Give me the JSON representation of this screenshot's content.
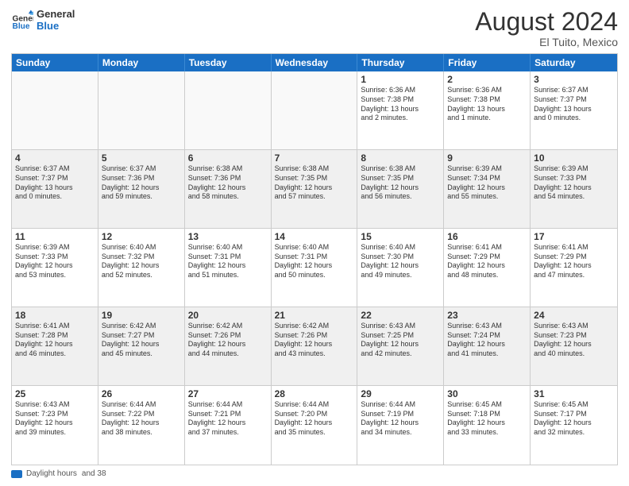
{
  "logo": {
    "line1": "General",
    "line2": "Blue"
  },
  "title": "August 2024",
  "location": "El Tuito, Mexico",
  "header_days": [
    "Sunday",
    "Monday",
    "Tuesday",
    "Wednesday",
    "Thursday",
    "Friday",
    "Saturday"
  ],
  "legend": {
    "label": "Daylight hours",
    "sublabel": "and 38"
  },
  "weeks": [
    {
      "alt": false,
      "days": [
        {
          "num": "",
          "empty": true,
          "lines": []
        },
        {
          "num": "",
          "empty": true,
          "lines": []
        },
        {
          "num": "",
          "empty": true,
          "lines": []
        },
        {
          "num": "",
          "empty": true,
          "lines": []
        },
        {
          "num": "1",
          "empty": false,
          "lines": [
            "Sunrise: 6:36 AM",
            "Sunset: 7:38 PM",
            "Daylight: 13 hours",
            "and 2 minutes."
          ]
        },
        {
          "num": "2",
          "empty": false,
          "lines": [
            "Sunrise: 6:36 AM",
            "Sunset: 7:38 PM",
            "Daylight: 13 hours",
            "and 1 minute."
          ]
        },
        {
          "num": "3",
          "empty": false,
          "lines": [
            "Sunrise: 6:37 AM",
            "Sunset: 7:37 PM",
            "Daylight: 13 hours",
            "and 0 minutes."
          ]
        }
      ]
    },
    {
      "alt": true,
      "days": [
        {
          "num": "4",
          "empty": false,
          "lines": [
            "Sunrise: 6:37 AM",
            "Sunset: 7:37 PM",
            "Daylight: 13 hours",
            "and 0 minutes."
          ]
        },
        {
          "num": "5",
          "empty": false,
          "lines": [
            "Sunrise: 6:37 AM",
            "Sunset: 7:36 PM",
            "Daylight: 12 hours",
            "and 59 minutes."
          ]
        },
        {
          "num": "6",
          "empty": false,
          "lines": [
            "Sunrise: 6:38 AM",
            "Sunset: 7:36 PM",
            "Daylight: 12 hours",
            "and 58 minutes."
          ]
        },
        {
          "num": "7",
          "empty": false,
          "lines": [
            "Sunrise: 6:38 AM",
            "Sunset: 7:35 PM",
            "Daylight: 12 hours",
            "and 57 minutes."
          ]
        },
        {
          "num": "8",
          "empty": false,
          "lines": [
            "Sunrise: 6:38 AM",
            "Sunset: 7:35 PM",
            "Daylight: 12 hours",
            "and 56 minutes."
          ]
        },
        {
          "num": "9",
          "empty": false,
          "lines": [
            "Sunrise: 6:39 AM",
            "Sunset: 7:34 PM",
            "Daylight: 12 hours",
            "and 55 minutes."
          ]
        },
        {
          "num": "10",
          "empty": false,
          "lines": [
            "Sunrise: 6:39 AM",
            "Sunset: 7:33 PM",
            "Daylight: 12 hours",
            "and 54 minutes."
          ]
        }
      ]
    },
    {
      "alt": false,
      "days": [
        {
          "num": "11",
          "empty": false,
          "lines": [
            "Sunrise: 6:39 AM",
            "Sunset: 7:33 PM",
            "Daylight: 12 hours",
            "and 53 minutes."
          ]
        },
        {
          "num": "12",
          "empty": false,
          "lines": [
            "Sunrise: 6:40 AM",
            "Sunset: 7:32 PM",
            "Daylight: 12 hours",
            "and 52 minutes."
          ]
        },
        {
          "num": "13",
          "empty": false,
          "lines": [
            "Sunrise: 6:40 AM",
            "Sunset: 7:31 PM",
            "Daylight: 12 hours",
            "and 51 minutes."
          ]
        },
        {
          "num": "14",
          "empty": false,
          "lines": [
            "Sunrise: 6:40 AM",
            "Sunset: 7:31 PM",
            "Daylight: 12 hours",
            "and 50 minutes."
          ]
        },
        {
          "num": "15",
          "empty": false,
          "lines": [
            "Sunrise: 6:40 AM",
            "Sunset: 7:30 PM",
            "Daylight: 12 hours",
            "and 49 minutes."
          ]
        },
        {
          "num": "16",
          "empty": false,
          "lines": [
            "Sunrise: 6:41 AM",
            "Sunset: 7:29 PM",
            "Daylight: 12 hours",
            "and 48 minutes."
          ]
        },
        {
          "num": "17",
          "empty": false,
          "lines": [
            "Sunrise: 6:41 AM",
            "Sunset: 7:29 PM",
            "Daylight: 12 hours",
            "and 47 minutes."
          ]
        }
      ]
    },
    {
      "alt": true,
      "days": [
        {
          "num": "18",
          "empty": false,
          "lines": [
            "Sunrise: 6:41 AM",
            "Sunset: 7:28 PM",
            "Daylight: 12 hours",
            "and 46 minutes."
          ]
        },
        {
          "num": "19",
          "empty": false,
          "lines": [
            "Sunrise: 6:42 AM",
            "Sunset: 7:27 PM",
            "Daylight: 12 hours",
            "and 45 minutes."
          ]
        },
        {
          "num": "20",
          "empty": false,
          "lines": [
            "Sunrise: 6:42 AM",
            "Sunset: 7:26 PM",
            "Daylight: 12 hours",
            "and 44 minutes."
          ]
        },
        {
          "num": "21",
          "empty": false,
          "lines": [
            "Sunrise: 6:42 AM",
            "Sunset: 7:26 PM",
            "Daylight: 12 hours",
            "and 43 minutes."
          ]
        },
        {
          "num": "22",
          "empty": false,
          "lines": [
            "Sunrise: 6:43 AM",
            "Sunset: 7:25 PM",
            "Daylight: 12 hours",
            "and 42 minutes."
          ]
        },
        {
          "num": "23",
          "empty": false,
          "lines": [
            "Sunrise: 6:43 AM",
            "Sunset: 7:24 PM",
            "Daylight: 12 hours",
            "and 41 minutes."
          ]
        },
        {
          "num": "24",
          "empty": false,
          "lines": [
            "Sunrise: 6:43 AM",
            "Sunset: 7:23 PM",
            "Daylight: 12 hours",
            "and 40 minutes."
          ]
        }
      ]
    },
    {
      "alt": false,
      "days": [
        {
          "num": "25",
          "empty": false,
          "lines": [
            "Sunrise: 6:43 AM",
            "Sunset: 7:23 PM",
            "Daylight: 12 hours",
            "and 39 minutes."
          ]
        },
        {
          "num": "26",
          "empty": false,
          "lines": [
            "Sunrise: 6:44 AM",
            "Sunset: 7:22 PM",
            "Daylight: 12 hours",
            "and 38 minutes."
          ]
        },
        {
          "num": "27",
          "empty": false,
          "lines": [
            "Sunrise: 6:44 AM",
            "Sunset: 7:21 PM",
            "Daylight: 12 hours",
            "and 37 minutes."
          ]
        },
        {
          "num": "28",
          "empty": false,
          "lines": [
            "Sunrise: 6:44 AM",
            "Sunset: 7:20 PM",
            "Daylight: 12 hours",
            "and 35 minutes."
          ]
        },
        {
          "num": "29",
          "empty": false,
          "lines": [
            "Sunrise: 6:44 AM",
            "Sunset: 7:19 PM",
            "Daylight: 12 hours",
            "and 34 minutes."
          ]
        },
        {
          "num": "30",
          "empty": false,
          "lines": [
            "Sunrise: 6:45 AM",
            "Sunset: 7:18 PM",
            "Daylight: 12 hours",
            "and 33 minutes."
          ]
        },
        {
          "num": "31",
          "empty": false,
          "lines": [
            "Sunrise: 6:45 AM",
            "Sunset: 7:17 PM",
            "Daylight: 12 hours",
            "and 32 minutes."
          ]
        }
      ]
    }
  ]
}
